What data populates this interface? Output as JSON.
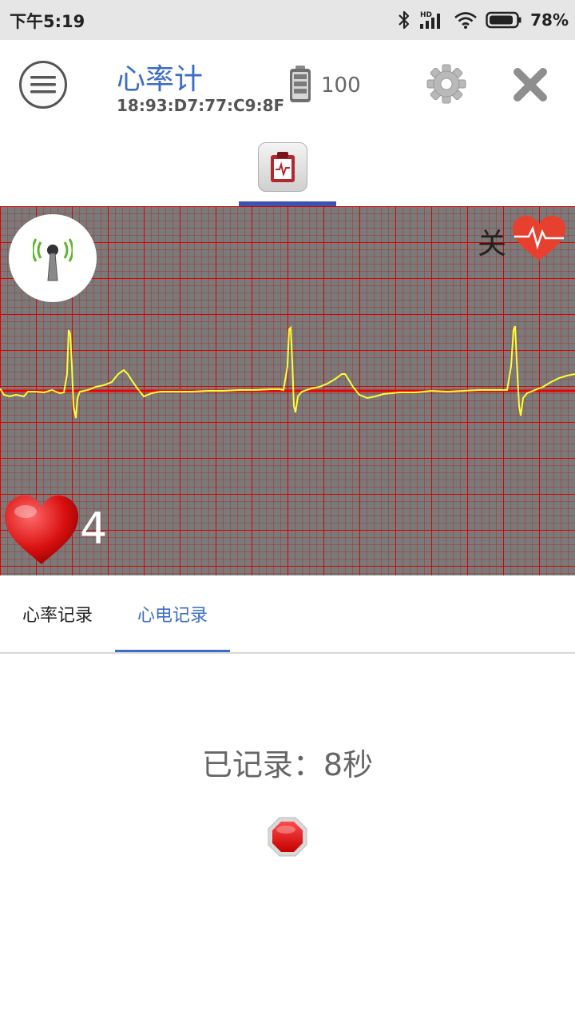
{
  "status_bar": {
    "time": "下午5:19",
    "network": "HD",
    "battery_percent": "78%"
  },
  "app_bar": {
    "title": "心率计",
    "device_mac": "18:93:D7:77:C9:8F",
    "device_battery": "100",
    "icons": [
      "menu-icon",
      "battery-icon",
      "settings-gear-icon",
      "close-icon"
    ]
  },
  "top_tabs": [
    {
      "icon": "clipboard-ecg-icon",
      "selected": true
    }
  ],
  "ecg_panel": {
    "grid_color": "#cc0000",
    "background": "#7a7a7a",
    "trace_color": "#ffff33",
    "alarm_label": "关",
    "heart_rate": "4"
  },
  "record_tabs": [
    {
      "label": "心率记录",
      "selected": false
    },
    {
      "label": "心电记录",
      "selected": true
    }
  ],
  "recording": {
    "status_text": "已记录：8秒",
    "stop_icon": "stop-octagon-icon"
  },
  "colors": {
    "accent": "#3b6cc7",
    "tab_indicator": "#3f51b5"
  }
}
